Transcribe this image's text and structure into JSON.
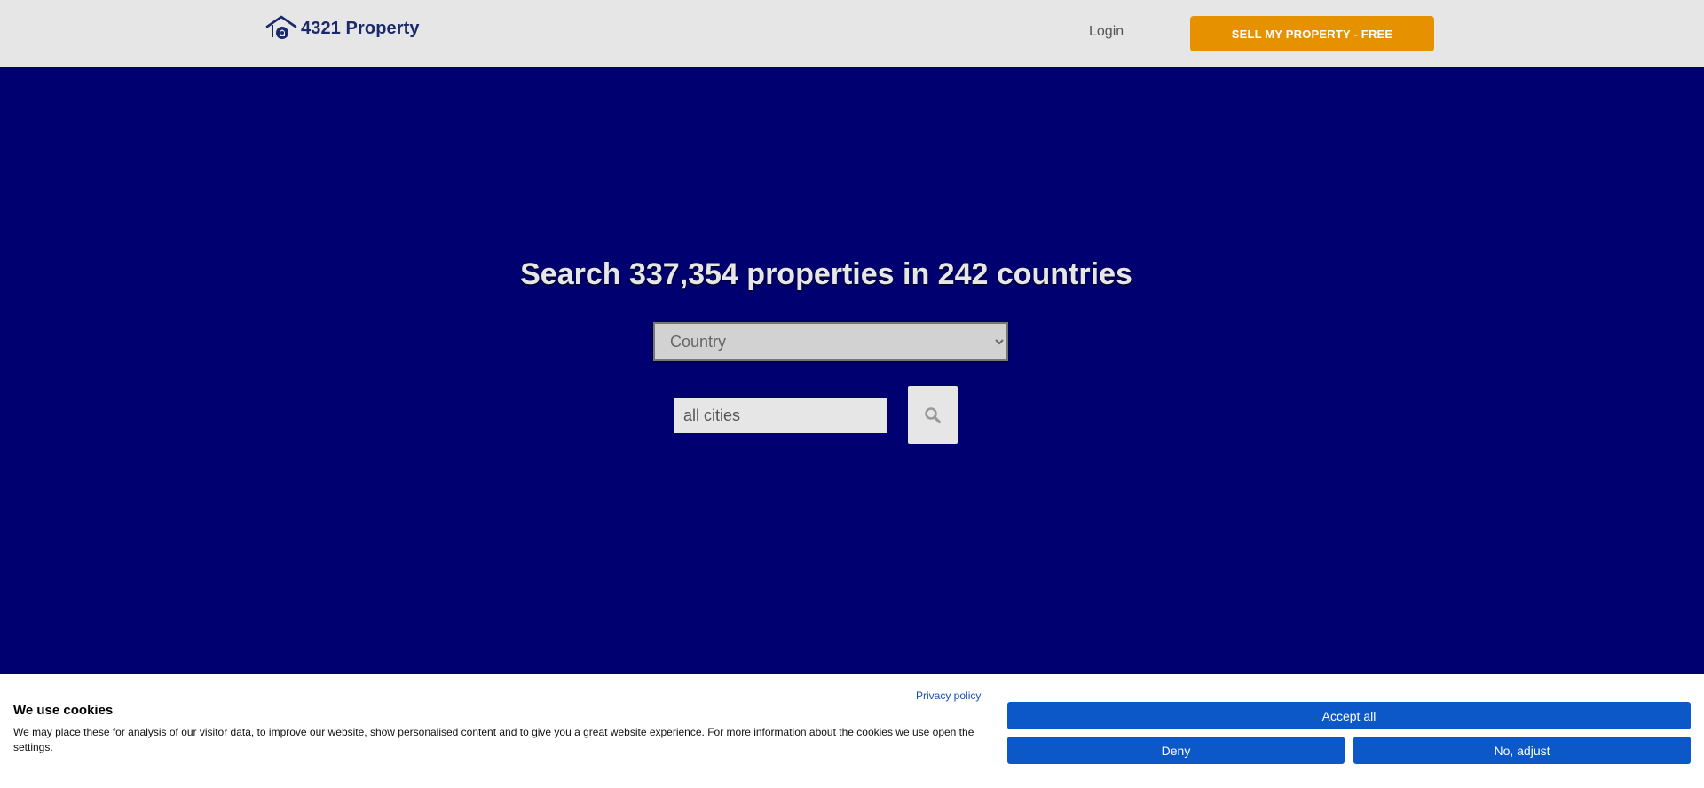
{
  "header": {
    "logo_text": "4321 Property",
    "login_label": "Login",
    "sell_label": "SELL MY PROPERTY - FREE",
    "sell_color": "#e69200"
  },
  "hero": {
    "title": "Search 337,354 properties in 242 countries",
    "background": "#000070",
    "country_select": {
      "selected": "Country",
      "options": [
        "Country"
      ]
    },
    "city_input": {
      "value": "",
      "placeholder": "all cities"
    },
    "search_icon": "search-icon"
  },
  "cookie_banner": {
    "title": "We use cookies",
    "text": "We may place these for analysis of our visitor data, to improve our website, show personalised content and to give you a great website experience. For more information about the cookies we use open the settings.",
    "privacy_link": "Privacy policy",
    "accept_label": "Accept all",
    "deny_label": "Deny",
    "adjust_label": "No, adjust",
    "button_color": "#0d58c8"
  }
}
